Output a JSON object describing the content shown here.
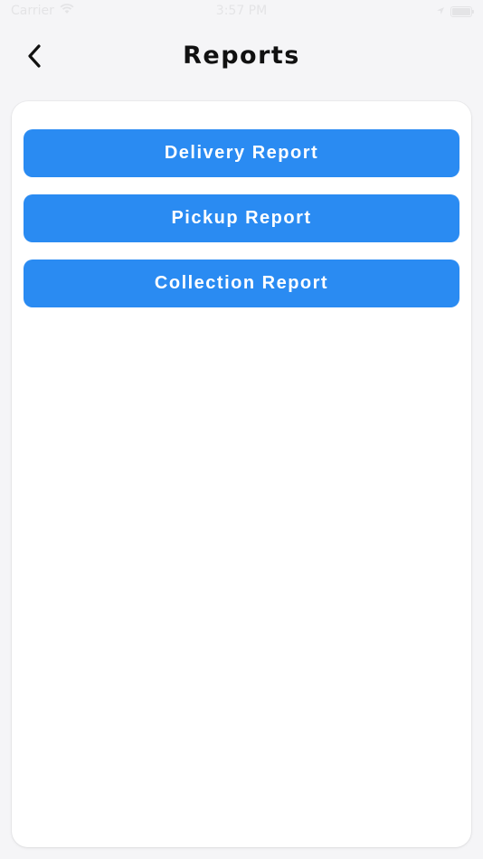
{
  "status_bar": {
    "carrier": "Carrier",
    "time": "3:57 PM"
  },
  "header": {
    "title": "Reports",
    "back_icon": "chevron-left-icon"
  },
  "reports": [
    {
      "label": "Delivery Report"
    },
    {
      "label": "Pickup Report"
    },
    {
      "label": "Collection Report"
    }
  ],
  "colors": {
    "button_blue": "#2a8bf2",
    "background": "#f5f5f7",
    "card": "#ffffff"
  }
}
